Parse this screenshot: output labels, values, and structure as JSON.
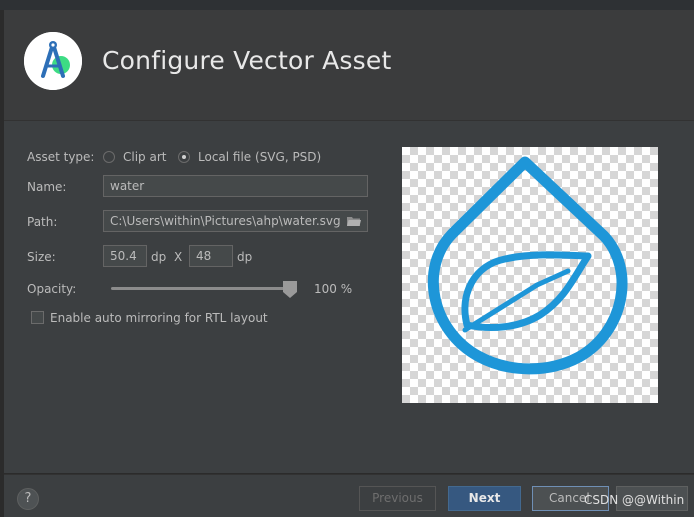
{
  "dialog": {
    "title": "Configure Vector Asset",
    "logo_icon": "android-studio-logo-icon"
  },
  "form": {
    "asset_type_label": "Asset type:",
    "clip_art_label": "Clip art",
    "local_file_label": "Local file (SVG, PSD)",
    "selected_asset_type": "Local file (SVG, PSD)",
    "name_label": "Name:",
    "name_value": "water",
    "path_label": "Path:",
    "path_value": "C:\\Users\\within\\Pictures\\ahp\\water.svg",
    "size_label": "Size:",
    "width_value": "50.4",
    "width_unit": "dp",
    "size_separator": "X",
    "height_value": "48",
    "height_unit": "dp",
    "opacity_label": "Opacity:",
    "opacity_value": "100 %",
    "opacity_level": 1.0,
    "auto_mirror_label": "Enable auto mirroring for RTL layout",
    "auto_mirror_checked": false
  },
  "preview": {
    "icon": "water-drop-leaf-icon",
    "icon_color": "#1e96d8"
  },
  "footer": {
    "help_label": "?",
    "previous_label": "Previous",
    "next_label": "Next",
    "cancel_label": "Cancel"
  },
  "watermark": "CSDN @@Within",
  "colors": {
    "header_bg": "#3b3c3d",
    "body_bg": "#3c3f41",
    "primary_button": "#365880"
  }
}
